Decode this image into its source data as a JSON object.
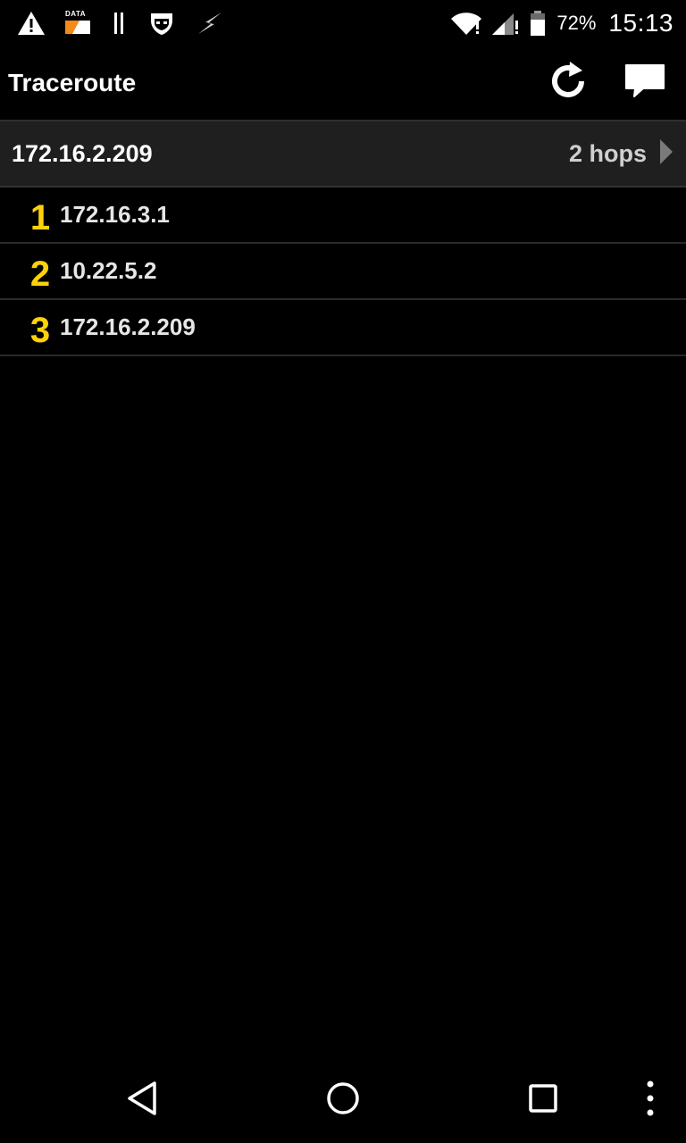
{
  "status_bar": {
    "icons_left": [
      "warning-icon",
      "data-icon",
      "pause-icon",
      "guard-icon",
      "bolt-icon"
    ],
    "data_icon_label": "DATA",
    "icons_right": [
      "wifi-icon",
      "signal-icon",
      "battery-icon"
    ],
    "battery_percent": "72%",
    "battery_level": 0.72,
    "time": "15:13"
  },
  "action_bar": {
    "title": "Traceroute",
    "actions": [
      "refresh-icon",
      "chat-icon"
    ]
  },
  "target": {
    "host": "172.16.2.209",
    "hops": "2 hops"
  },
  "hops": [
    {
      "number": "1",
      "address": "172.16.3.1"
    },
    {
      "number": "2",
      "address": "10.22.5.2"
    },
    {
      "number": "3",
      "address": "172.16.2.209"
    }
  ],
  "nav_bar": {
    "buttons": [
      "back-icon",
      "home-icon",
      "recents-icon",
      "menu-icon"
    ]
  },
  "colors": {
    "background": "#000000",
    "hop_number": "#ffd10a",
    "header_row": "#1f1f1f",
    "data_icon_accent": "#f28a1c"
  }
}
